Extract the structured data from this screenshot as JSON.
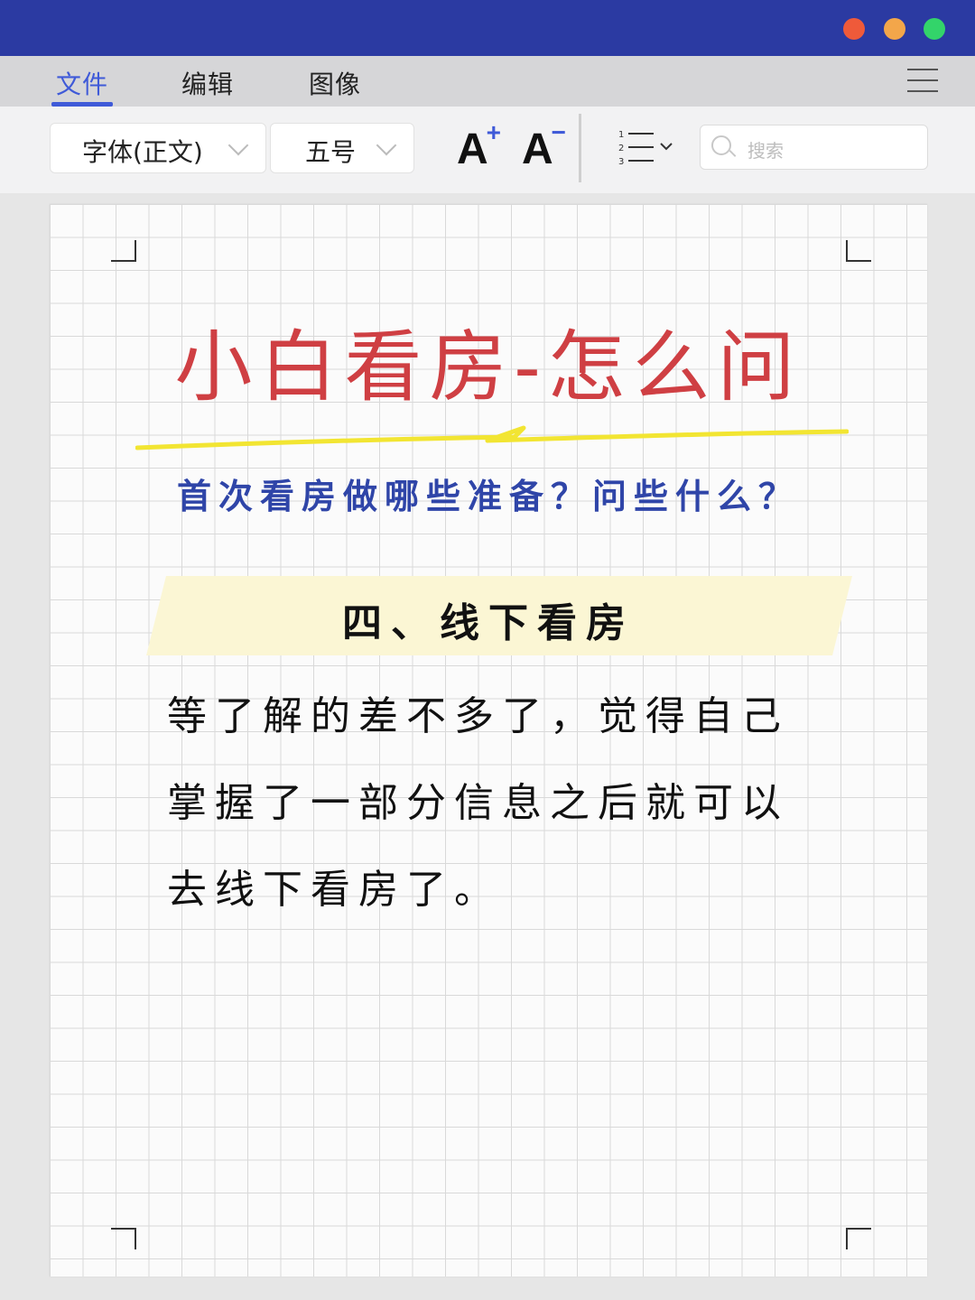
{
  "window": {
    "colors": {
      "titlebar": "#2b3aa2",
      "close": "#ef5a3a",
      "minimize": "#f3a64a",
      "zoom": "#33d46a"
    }
  },
  "menu": {
    "items": [
      {
        "label": "文件",
        "active": true
      },
      {
        "label": "编辑",
        "active": false
      },
      {
        "label": "图像",
        "active": false
      }
    ],
    "menu_icon": "hamburger-icon",
    "accent": "#3f5ad8"
  },
  "toolbar": {
    "font_family": "字体(正文)",
    "font_size": "五号",
    "increase_font": "A",
    "decrease_font": "A",
    "list_icon": "numbered-list-icon",
    "search_placeholder": "搜索"
  },
  "document": {
    "title": "小白看房-怎么问",
    "subtitle": "首次看房做哪些准备？问些什么？",
    "section_heading": "四、线下看房",
    "body": "等了解的差不多了，觉得自己掌握了一部分信息之后就可以去线下看房了。",
    "title_color": "#cf3f43",
    "subtitle_color": "#2f45a8",
    "underline_color": "#f2e532",
    "highlight_color": "#fbf6d4"
  }
}
